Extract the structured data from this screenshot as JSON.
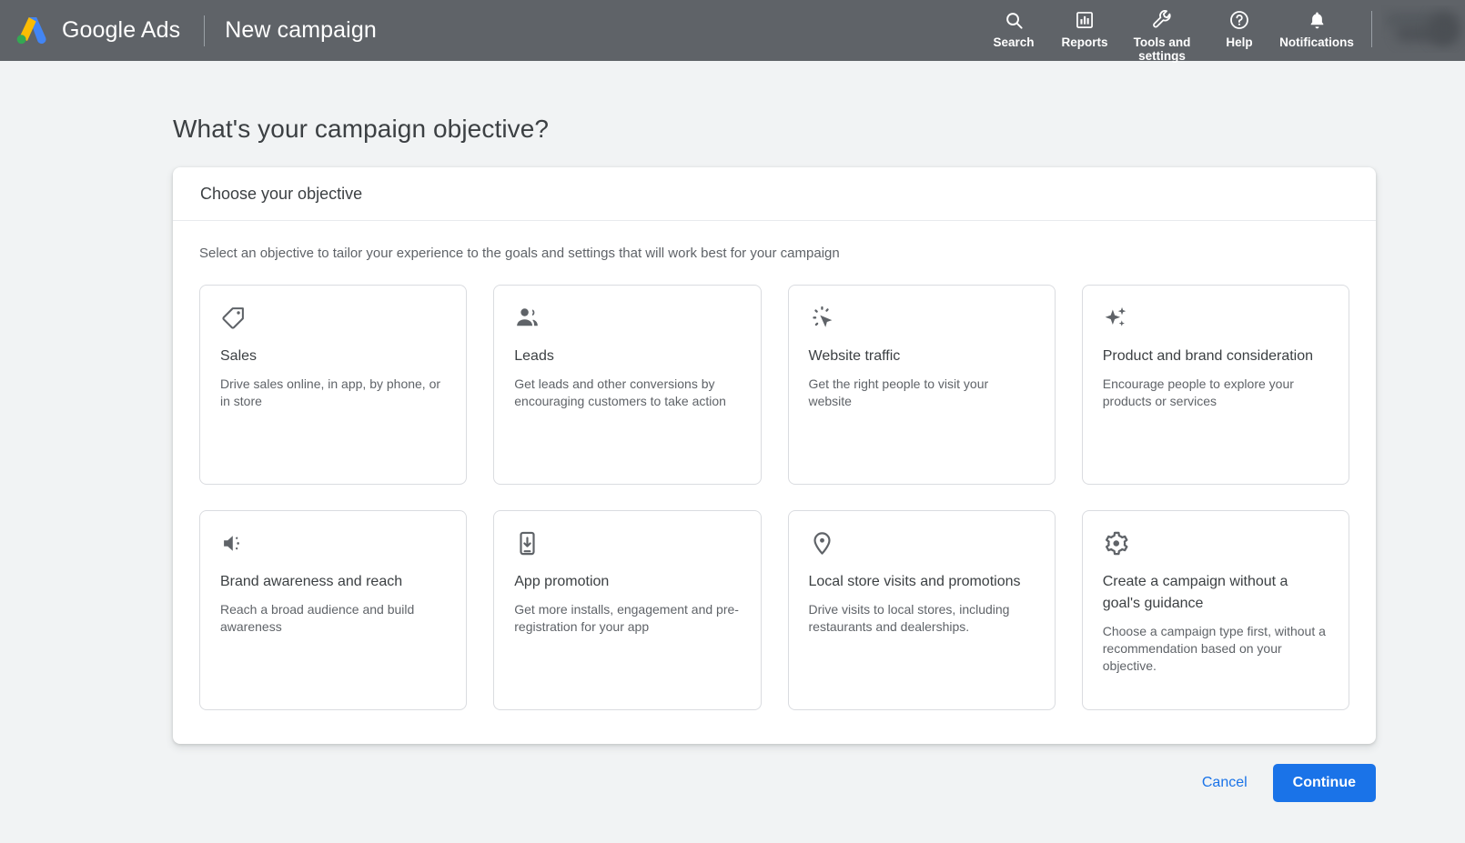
{
  "header": {
    "brand": "Google Ads",
    "page_title": "New campaign",
    "logo_icon": "google-ads-logo",
    "actions": [
      {
        "label": "Search",
        "icon": "search-icon"
      },
      {
        "label": "Reports",
        "icon": "reports-bar-chart-icon"
      },
      {
        "label": "Tools and\nsettings",
        "icon": "wrench-tools-icon"
      },
      {
        "label": "Help",
        "icon": "help-question-circle-icon"
      },
      {
        "label": "Notifications",
        "icon": "bell-notifications-icon"
      }
    ]
  },
  "main": {
    "headline": "What's your campaign objective?",
    "panel_title": "Choose your objective",
    "panel_subtitle": "Select an objective to tailor your experience to the goals and settings that will work best for your campaign",
    "objectives": [
      {
        "title": "Sales",
        "description": "Drive sales online, in app, by phone, or in store",
        "icon": "price-tag-icon"
      },
      {
        "title": "Leads",
        "description": "Get leads and other conversions by encouraging customers to take action",
        "icon": "people-group-icon"
      },
      {
        "title": "Website traffic",
        "description": "Get the right people to visit your website",
        "icon": "cursor-click-icon"
      },
      {
        "title": "Product and brand consideration",
        "description": "Encourage people to explore your products or services",
        "icon": "sparkles-icon"
      },
      {
        "title": "Brand awareness and reach",
        "description": "Reach a broad audience and build awareness",
        "icon": "speaker-volume-icon"
      },
      {
        "title": "App promotion",
        "description": "Get more installs, engagement and pre-registration for your app",
        "icon": "phone-download-icon"
      },
      {
        "title": "Local store visits and promotions",
        "description": "Drive visits to local stores, including restaurants and dealerships.",
        "icon": "map-pin-icon"
      },
      {
        "title": "Create a campaign without a goal's guidance",
        "description": "Choose a campaign type first, without a recommendation based on your objective.",
        "icon": "gear-settings-icon"
      }
    ]
  },
  "footer": {
    "cancel_label": "Cancel",
    "continue_label": "Continue"
  },
  "colors": {
    "topbar_bg": "#5f6368",
    "page_bg": "#f1f3f4",
    "accent_blue": "#1a73e8",
    "text_primary": "#3c4043",
    "text_secondary": "#5f6368",
    "card_border": "#dadce0"
  }
}
